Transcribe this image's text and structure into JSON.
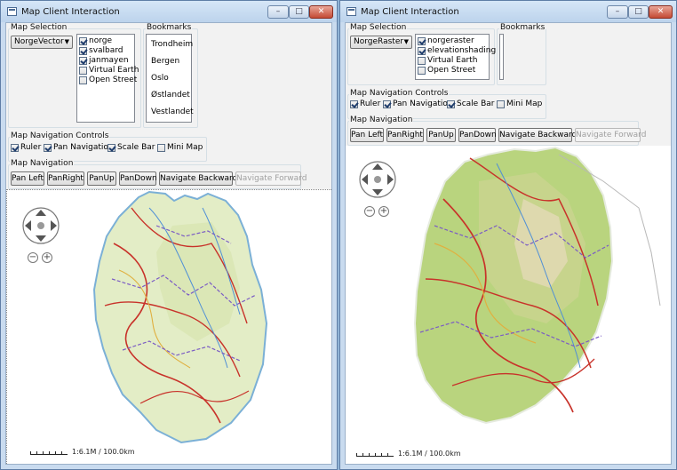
{
  "windows": [
    {
      "title": "Map Client Interaction",
      "window_controls": {
        "minimize": "–",
        "maximize": "□",
        "close": "✕"
      },
      "map_selection": {
        "label": "Map Selection",
        "selected_map": "NorgeVector",
        "layers": [
          {
            "label": "norge",
            "checked": true
          },
          {
            "label": "svalbard",
            "checked": true
          },
          {
            "label": "janmayen",
            "checked": true
          },
          {
            "label": "Virtual Earth",
            "checked": false
          },
          {
            "label": "Open Street",
            "checked": false
          }
        ]
      },
      "bookmarks": {
        "label": "Bookmarks",
        "items": [
          "Trondheim",
          "Bergen",
          "Oslo",
          "Østlandet",
          "Vestlandet"
        ]
      },
      "nav_controls": {
        "label": "Map Navigation Controls",
        "options": [
          {
            "label": "Ruler",
            "checked": true
          },
          {
            "label": "Pan Navigation",
            "checked": true
          },
          {
            "label": "Scale Bar",
            "checked": true
          },
          {
            "label": "Mini Map",
            "checked": false
          }
        ]
      },
      "navigation": {
        "label": "Map Navigation",
        "buttons": [
          {
            "label": "Pan Left",
            "enabled": true
          },
          {
            "label": "PanRight",
            "enabled": true
          },
          {
            "label": "PanUp",
            "enabled": true
          },
          {
            "label": "PanDown",
            "enabled": true
          },
          {
            "label": "Navigate Backward",
            "enabled": true
          },
          {
            "label": "Navigate Forward",
            "enabled": false
          }
        ]
      },
      "map": {
        "scale_text": "1:6.1M / 100.0km",
        "style": "vector"
      }
    },
    {
      "title": "Map Client Interaction",
      "window_controls": {
        "minimize": "–",
        "maximize": "□",
        "close": "✕"
      },
      "map_selection": {
        "label": "Map Selection",
        "selected_map": "NorgeRaster",
        "layers": [
          {
            "label": "norgeraster",
            "checked": true
          },
          {
            "label": "elevationshading",
            "checked": true
          },
          {
            "label": "Virtual Earth",
            "checked": false
          },
          {
            "label": "Open Street",
            "checked": false
          }
        ]
      },
      "bookmarks": {
        "label": "Bookmarks",
        "items": []
      },
      "nav_controls": {
        "label": "Map Navigation Controls",
        "options": [
          {
            "label": "Ruler",
            "checked": true
          },
          {
            "label": "Pan Navigation",
            "checked": true
          },
          {
            "label": "Scale Bar",
            "checked": true
          },
          {
            "label": "Mini Map",
            "checked": false
          }
        ]
      },
      "navigation": {
        "label": "Map Navigation",
        "buttons": [
          {
            "label": "Pan Left",
            "enabled": true
          },
          {
            "label": "PanRight",
            "enabled": true
          },
          {
            "label": "PanUp",
            "enabled": true
          },
          {
            "label": "PanDown",
            "enabled": true
          },
          {
            "label": "Navigate Backward",
            "enabled": true
          },
          {
            "label": "Navigate Forward",
            "enabled": false
          }
        ]
      },
      "map": {
        "scale_text": "1:6.1M / 100.0km",
        "style": "raster"
      }
    }
  ],
  "colors": {
    "titlebar": "#c9dbef",
    "close_button": "#c44a35",
    "land_vector": "#e3edc6",
    "land_raster": "#b9d47e",
    "roads": "#c8322a",
    "rivers": "#4f8fd6",
    "borders": "#7b5cc4"
  }
}
